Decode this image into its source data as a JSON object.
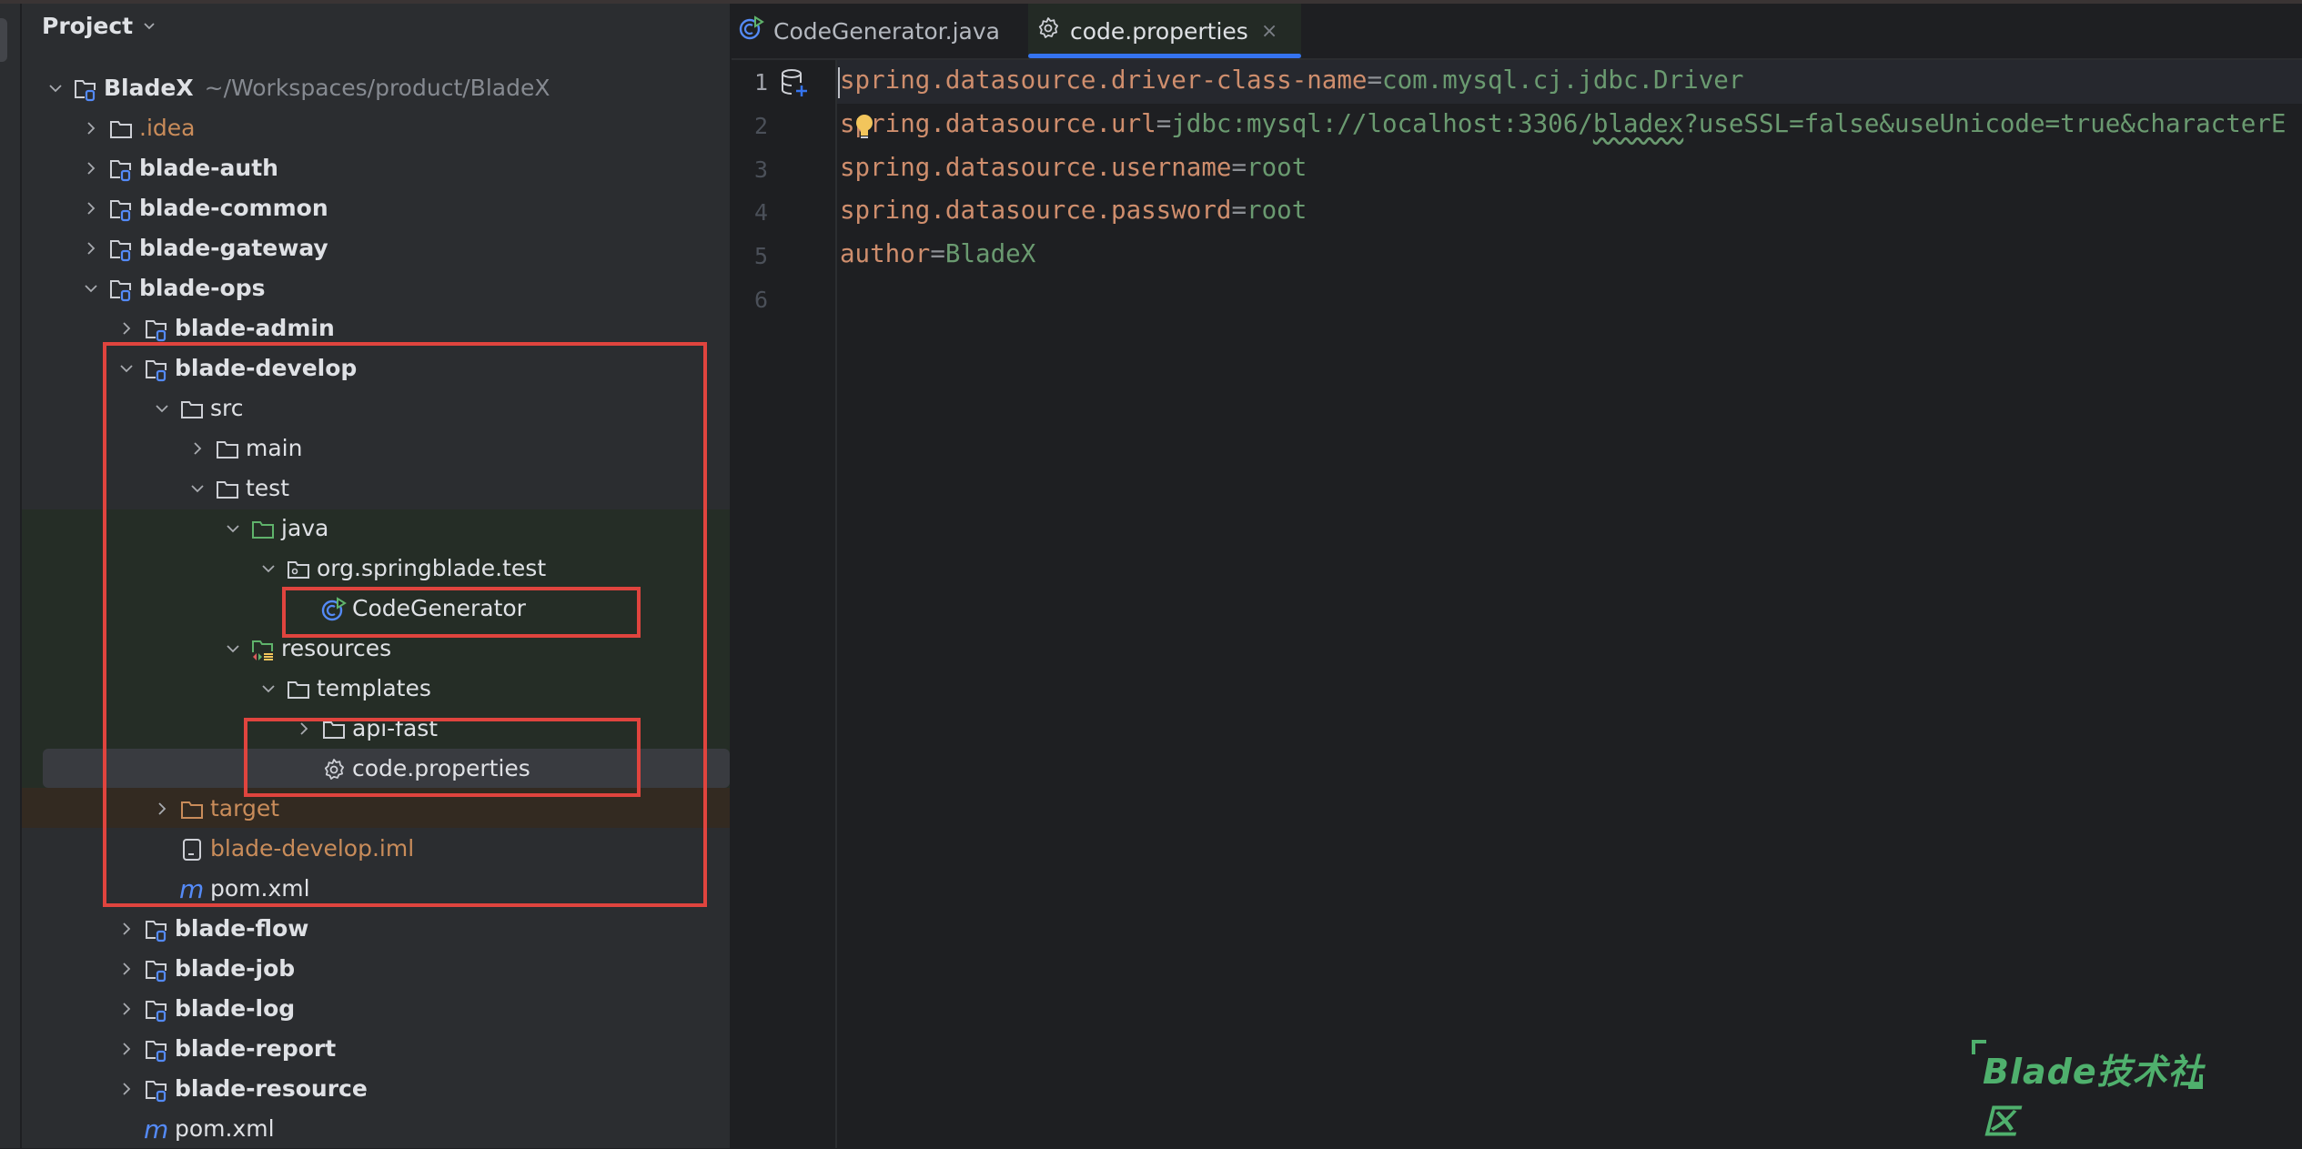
{
  "sidebar": {
    "title": "Project",
    "tree": [
      {
        "label": "BladeX",
        "path": "~/Workspaces/product/BladeX",
        "level": 0,
        "chevron": "down",
        "icon": "module-folder",
        "style": "bold"
      },
      {
        "label": ".idea",
        "level": 1,
        "chevron": "right",
        "icon": "folder",
        "style": "orange"
      },
      {
        "label": "blade-auth",
        "level": 1,
        "chevron": "right",
        "icon": "module-folder",
        "style": "bold"
      },
      {
        "label": "blade-common",
        "level": 1,
        "chevron": "right",
        "icon": "module-folder",
        "style": "bold"
      },
      {
        "label": "blade-gateway",
        "level": 1,
        "chevron": "right",
        "icon": "module-folder",
        "style": "bold"
      },
      {
        "label": "blade-ops",
        "level": 1,
        "chevron": "down",
        "icon": "module-folder",
        "style": "bold"
      },
      {
        "label": "blade-admin",
        "level": 2,
        "chevron": "right",
        "icon": "module-folder",
        "style": "bold"
      },
      {
        "label": "blade-develop",
        "level": 2,
        "chevron": "down",
        "icon": "module-folder",
        "style": "bold"
      },
      {
        "label": "src",
        "level": 3,
        "chevron": "down",
        "icon": "folder",
        "style": "normal"
      },
      {
        "label": "main",
        "level": 4,
        "chevron": "right",
        "icon": "folder",
        "style": "normal"
      },
      {
        "label": "test",
        "level": 4,
        "chevron": "down",
        "icon": "folder",
        "style": "normal"
      },
      {
        "label": "java",
        "level": 5,
        "chevron": "down",
        "icon": "test-source-folder",
        "style": "normal"
      },
      {
        "label": "org.springblade.test",
        "level": 6,
        "chevron": "down",
        "icon": "package-folder",
        "style": "normal"
      },
      {
        "label": "CodeGenerator",
        "level": 7,
        "chevron": "none",
        "icon": "java-class-runnable",
        "style": "normal"
      },
      {
        "label": "resources",
        "level": 5,
        "chevron": "down",
        "icon": "test-resources-folder",
        "style": "normal"
      },
      {
        "label": "templates",
        "level": 6,
        "chevron": "down",
        "icon": "folder",
        "style": "normal"
      },
      {
        "label": "api-fast",
        "level": 7,
        "chevron": "right",
        "icon": "folder",
        "style": "normal"
      },
      {
        "label": "code.properties",
        "level": 7,
        "chevron": "none",
        "icon": "gear",
        "style": "normal",
        "selected": true
      },
      {
        "label": "target",
        "level": 3,
        "chevron": "right",
        "icon": "excluded-folder",
        "style": "orange"
      },
      {
        "label": "blade-develop.iml",
        "level": 3,
        "chevron": "none",
        "icon": "module-file",
        "style": "orange"
      },
      {
        "label": "pom.xml",
        "level": 3,
        "chevron": "none",
        "icon": "maven",
        "style": "normal"
      },
      {
        "label": "blade-flow",
        "level": 2,
        "chevron": "right",
        "icon": "module-folder",
        "style": "bold"
      },
      {
        "label": "blade-job",
        "level": 2,
        "chevron": "right",
        "icon": "module-folder",
        "style": "bold"
      },
      {
        "label": "blade-log",
        "level": 2,
        "chevron": "right",
        "icon": "module-folder",
        "style": "bold"
      },
      {
        "label": "blade-report",
        "level": 2,
        "chevron": "right",
        "icon": "module-folder",
        "style": "bold"
      },
      {
        "label": "blade-resource",
        "level": 2,
        "chevron": "right",
        "icon": "module-folder",
        "style": "bold"
      },
      {
        "label": "pom.xml",
        "level": 2,
        "chevron": "none",
        "icon": "maven",
        "style": "normal"
      }
    ]
  },
  "tabs": [
    {
      "label": "CodeGenerator.java",
      "icon": "java-class-runnable",
      "active": false
    },
    {
      "label": "code.properties",
      "icon": "gear",
      "active": true,
      "close": "×"
    }
  ],
  "editor": {
    "current_line": 1,
    "lines": [
      {
        "num": "1",
        "key": "spring.datasource.driver-class-name",
        "eq": "=",
        "value": "com.mysql.cj.jdbc.Driver"
      },
      {
        "num": "2",
        "key": "spring.datasource.url",
        "eq": "=",
        "value_pre": "jdbc:mysql://localhost:3306/",
        "value_warn": "bladex",
        "value_post": "?useSSL=false&useUnicode=true&characterE"
      },
      {
        "num": "3",
        "key": "spring.datasource.username",
        "eq": "=",
        "value": "root"
      },
      {
        "num": "4",
        "key": "spring.datasource.password",
        "eq": "=",
        "value": "root"
      },
      {
        "num": "5",
        "key": "author",
        "eq": "=",
        "value": "BladeX"
      },
      {
        "num": "6"
      }
    ]
  },
  "watermark": {
    "text": "Blade技术社区",
    "color": "#4fb06d"
  },
  "colors": {
    "accent": "#3574f0",
    "highlight_box": "#e0443e",
    "key": "#cf8e6d",
    "value": "#6a9a70"
  }
}
